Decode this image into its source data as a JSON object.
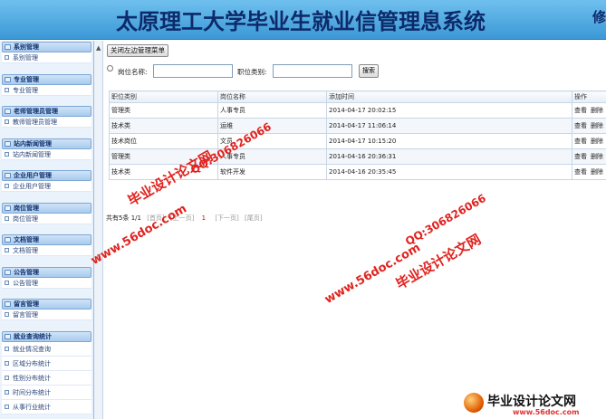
{
  "header": {
    "title": "太原理工大学毕业生就业信管理息系统",
    "right_text": "修"
  },
  "sidebar": {
    "groups": [
      {
        "title": "系别管理",
        "items": [
          "系别管理"
        ]
      },
      {
        "title": "专业管理",
        "items": [
          "专业管理"
        ]
      },
      {
        "title": "老师管理员管理",
        "items": [
          "教师管理员管理"
        ]
      },
      {
        "title": "站内新闻管理",
        "items": [
          "站内新闻管理"
        ]
      },
      {
        "title": "企业用户管理",
        "items": [
          "企业用户管理"
        ]
      },
      {
        "title": "岗位管理",
        "items": [
          "岗位管理"
        ]
      },
      {
        "title": "文档管理",
        "items": [
          "文档管理"
        ]
      },
      {
        "title": "公告管理",
        "items": [
          "公告管理"
        ]
      },
      {
        "title": "留言管理",
        "items": [
          "留言管理"
        ]
      }
    ],
    "stats": {
      "title": "就业查询统计",
      "items": [
        "就业情况查询",
        "区域分布统计",
        "性别分布统计",
        "时间分布统计",
        "从事行业统计"
      ]
    }
  },
  "splitter": {
    "arrow": "▲",
    "grip": "⠿"
  },
  "main": {
    "close_button": "关闭左边管理菜单",
    "search": {
      "position_label": "岗位名称:",
      "position_value": "",
      "category_label": "职位类别:",
      "category_value": "",
      "button": "搜索"
    },
    "table": {
      "headers": [
        "职位类别",
        "岗位名称",
        "添加时间",
        "操作"
      ],
      "rows": [
        {
          "category": "管理类",
          "name": "人事专员",
          "time": "2014-04-17 20:02:15",
          "view": "查看",
          "del": "删除"
        },
        {
          "category": "技术类",
          "name": "运维",
          "time": "2014-04-17 11:06:14",
          "view": "查看",
          "del": "删除"
        },
        {
          "category": "技术岗位",
          "name": "文员",
          "time": "2014-04-17 10:15:20",
          "view": "查看",
          "del": "删除"
        },
        {
          "category": "管理类",
          "name": "人事专员",
          "time": "2014-04-16 20:36:31",
          "view": "查看",
          "del": "删除"
        },
        {
          "category": "技术类",
          "name": "软件开发",
          "time": "2014-04-16 20:35:45",
          "view": "查看",
          "del": "删除"
        }
      ]
    },
    "pager": {
      "total": "共有5条",
      "page": "1/1",
      "first": "[首页]",
      "prev": "[上一页]",
      "current": "1",
      "next": "[下一页]",
      "last": "[尾页]"
    }
  },
  "watermarks": {
    "site": "www.56doc.com",
    "qq": "QQ:306826066",
    "cn": "毕业设计论文网"
  },
  "logo": {
    "text": "毕业设计论文网",
    "sub": "www.56doc.com"
  }
}
